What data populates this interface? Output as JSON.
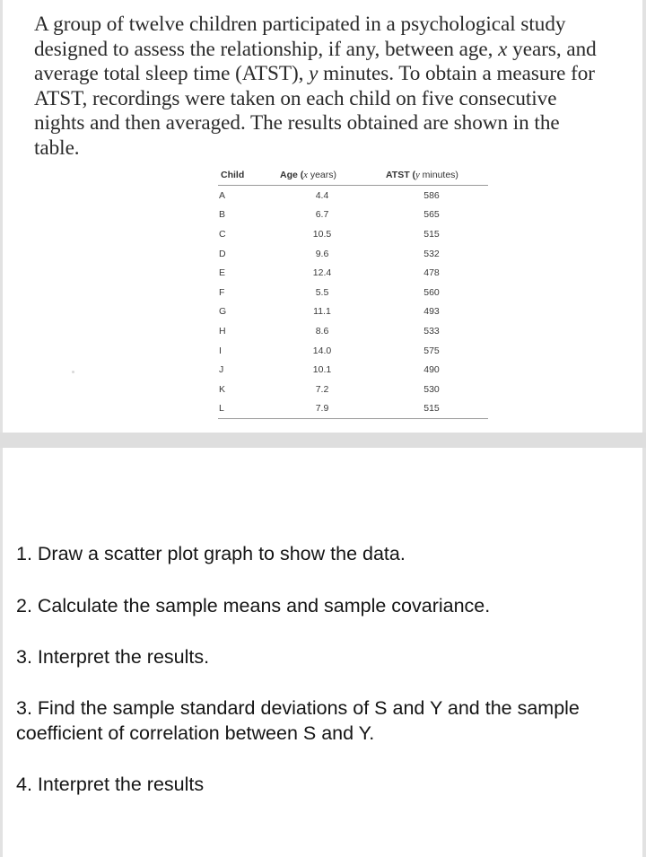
{
  "problem": {
    "intro_parts": [
      "A group of twelve children participated in a psychological study designed to assess the relationship, if any, between age, ",
      "x",
      " years, and average total sleep time (ATST), ",
      "y",
      " minutes.  To obtain a measure for ATST, recordings were taken on each child on five consecutive nights and then averaged.  The results obtained are shown in the table."
    ]
  },
  "table": {
    "headers": {
      "child": "Child",
      "age_prefix": "Age (",
      "age_var": "x",
      "age_suffix": " years)",
      "atst_prefix": "ATST (",
      "atst_var": "y",
      "atst_suffix": " minutes)"
    },
    "rows": [
      {
        "child": "A",
        "age": "4.4",
        "atst": "586"
      },
      {
        "child": "B",
        "age": "6.7",
        "atst": "565"
      },
      {
        "child": "C",
        "age": "10.5",
        "atst": "515"
      },
      {
        "child": "D",
        "age": "9.6",
        "atst": "532"
      },
      {
        "child": "E",
        "age": "12.4",
        "atst": "478"
      },
      {
        "child": "F",
        "age": "5.5",
        "atst": "560"
      },
      {
        "child": "G",
        "age": "11.1",
        "atst": "493"
      },
      {
        "child": "H",
        "age": "8.6",
        "atst": "533"
      },
      {
        "child": "I",
        "age": "14.0",
        "atst": "575"
      },
      {
        "child": "J",
        "age": "10.1",
        "atst": "490"
      },
      {
        "child": "K",
        "age": "7.2",
        "atst": "530"
      },
      {
        "child": "L",
        "age": "7.9",
        "atst": "515"
      }
    ]
  },
  "questions": [
    "1.  Draw a scatter plot graph to show the data.",
    "2. Calculate the sample means and sample covariance.",
    "3. Interpret the results.",
    "3. Find the sample standard deviations of S and Y and the sample coefficient of correlation between S and Y.",
    "4. Interpret the results"
  ]
}
